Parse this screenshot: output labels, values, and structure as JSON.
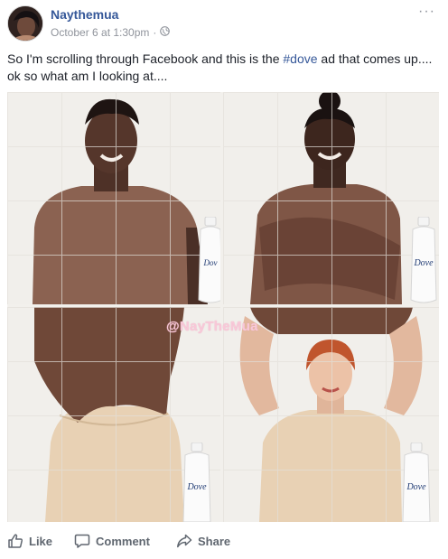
{
  "post": {
    "author": "Naythemua",
    "timestamp": "October 6 at 1:30pm",
    "separator": "·",
    "audience_icon": "globe-icon",
    "more_label": "···",
    "text_before": "So I'm scrolling through Facebook and this is the ",
    "hashtag": "#dove",
    "text_after": " ad that comes up.... ok so what am I looking at....",
    "photo": {
      "watermark": "@NayTheMua",
      "bottle_brand": "Dove"
    }
  },
  "actions": {
    "like": "Like",
    "comment": "Comment",
    "share": "Share"
  },
  "colors": {
    "link": "#365899",
    "meta": "#90949c",
    "action": "#606770",
    "shirt": "#8b6251",
    "camisole": "#e9d2b5"
  }
}
